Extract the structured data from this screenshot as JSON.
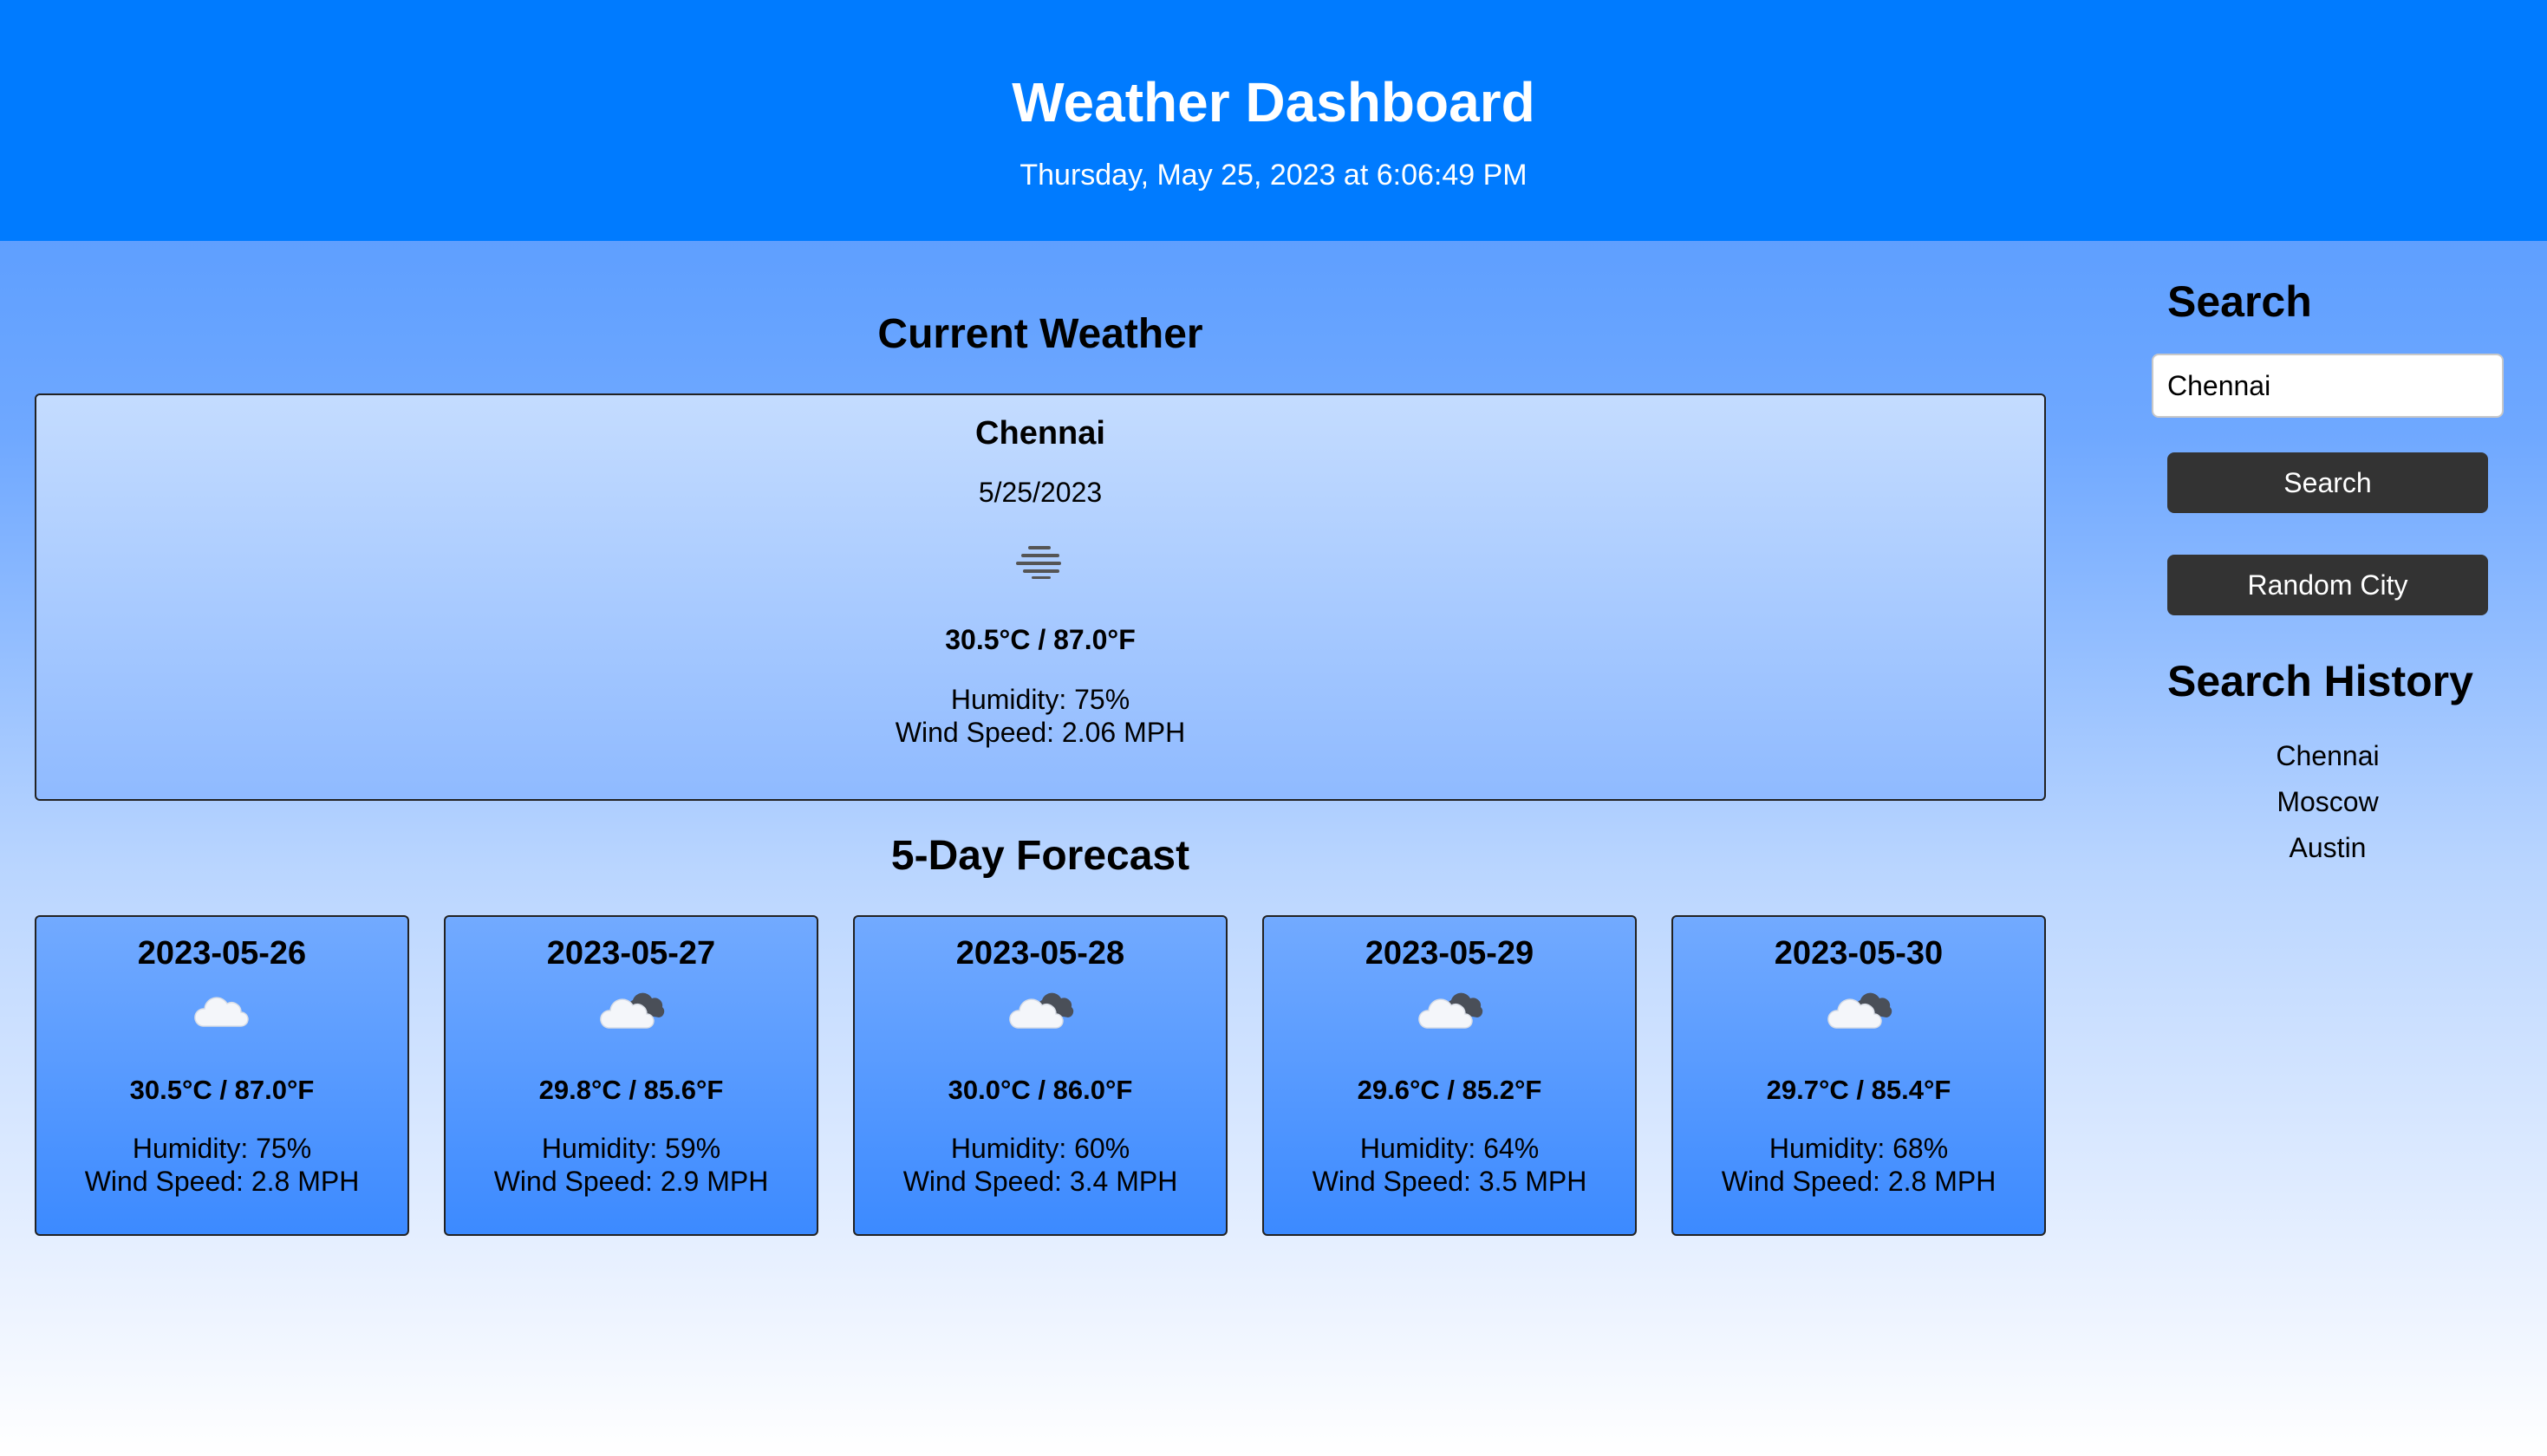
{
  "header": {
    "title": "Weather Dashboard",
    "datetime": "Thursday, May 25, 2023 at 6:06:49 PM"
  },
  "current": {
    "section_title": "Current Weather",
    "city": "Chennai",
    "date": "5/25/2023",
    "icon": "mist-icon",
    "temp": "30.5°C / 87.0°F",
    "humidity": "Humidity: 75%",
    "wind": "Wind Speed: 2.06 MPH"
  },
  "forecast": {
    "section_title": "5-Day Forecast",
    "days": [
      {
        "date": "2023-05-26",
        "icon": "cloud-icon",
        "temp": "30.5°C / 87.0°F",
        "humidity": "Humidity: 75%",
        "wind": "Wind Speed: 2.8 MPH"
      },
      {
        "date": "2023-05-27",
        "icon": "broken-clouds-icon",
        "temp": "29.8°C / 85.6°F",
        "humidity": "Humidity: 59%",
        "wind": "Wind Speed: 2.9 MPH"
      },
      {
        "date": "2023-05-28",
        "icon": "broken-clouds-icon",
        "temp": "30.0°C / 86.0°F",
        "humidity": "Humidity: 60%",
        "wind": "Wind Speed: 3.4 MPH"
      },
      {
        "date": "2023-05-29",
        "icon": "broken-clouds-icon",
        "temp": "29.6°C / 85.2°F",
        "humidity": "Humidity: 64%",
        "wind": "Wind Speed: 3.5 MPH"
      },
      {
        "date": "2023-05-30",
        "icon": "broken-clouds-icon",
        "temp": "29.7°C / 85.4°F",
        "humidity": "Humidity: 68%",
        "wind": "Wind Speed: 2.8 MPH"
      }
    ]
  },
  "sidebar": {
    "search_title": "Search",
    "search_value": "Chennai",
    "search_button": "Search",
    "random_button": "Random City",
    "history_title": "Search History",
    "history": [
      "Chennai",
      "Moscow",
      "Austin"
    ]
  },
  "colors": {
    "header_bg": "#007bff",
    "button_bg": "#333333"
  }
}
